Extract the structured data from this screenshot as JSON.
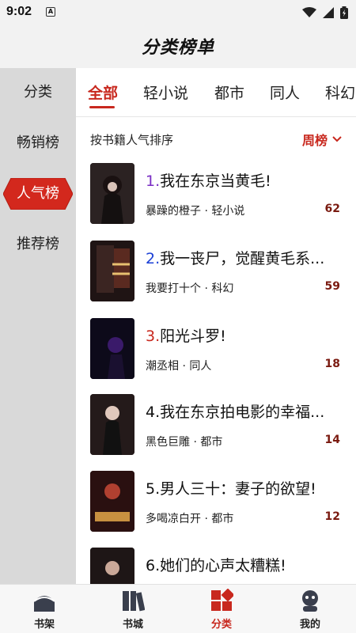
{
  "status_bar": {
    "time": "9:02",
    "notification_icon": "a-icon"
  },
  "header": {
    "title": "分类榜单"
  },
  "sidebar": {
    "items": [
      {
        "label": "分类",
        "active": false
      },
      {
        "label": "畅销榜",
        "active": false
      },
      {
        "label": "人气榜",
        "active": true
      },
      {
        "label": "推荐榜",
        "active": false
      }
    ]
  },
  "tabs": [
    {
      "label": "全部",
      "active": true
    },
    {
      "label": "轻小说",
      "active": false
    },
    {
      "label": "都市",
      "active": false
    },
    {
      "label": "同人",
      "active": false
    },
    {
      "label": "科幻",
      "active": false
    }
  ],
  "sort": {
    "label": "按书籍人气排序",
    "period": "周榜"
  },
  "books": [
    {
      "rank": "1.",
      "rank_color": "#7a2ec4",
      "title": "我在东京当黄毛!",
      "meta": "暴躁的橙子 · 轻小说",
      "count": "62"
    },
    {
      "rank": "2.",
      "rank_color": "#1a3fd6",
      "title": "我一丧尸，觉醒黄毛系...",
      "meta": "我要打十个 · 科幻",
      "count": "59"
    },
    {
      "rank": "3.",
      "rank_color": "#c8281e",
      "title": "阳光斗罗!",
      "meta": "潮丞相 · 同人",
      "count": "18"
    },
    {
      "rank": "4.",
      "rank_color": "#111111",
      "title": "我在东京拍电影的幸福...",
      "meta": "黑色巨雕 · 都市",
      "count": "14"
    },
    {
      "rank": "5.",
      "rank_color": "#111111",
      "title": "男人三十：妻子的欲望!",
      "meta": "多喝凉白开 · 都市",
      "count": "12"
    },
    {
      "rank": "6.",
      "rank_color": "#111111",
      "title": "她们的心声太糟糕!",
      "meta": "",
      "count": ""
    }
  ],
  "bottom_nav": [
    {
      "label": "书架",
      "icon": "bookshelf-icon",
      "active": false
    },
    {
      "label": "书城",
      "icon": "bookstore-icon",
      "active": false
    },
    {
      "label": "分类",
      "icon": "category-icon",
      "active": true
    },
    {
      "label": "我的",
      "icon": "profile-icon",
      "active": false
    }
  ],
  "colors": {
    "accent": "#c8281e",
    "sidebar_bg": "#d9d9d9",
    "header_bg": "#f2f2f2"
  }
}
